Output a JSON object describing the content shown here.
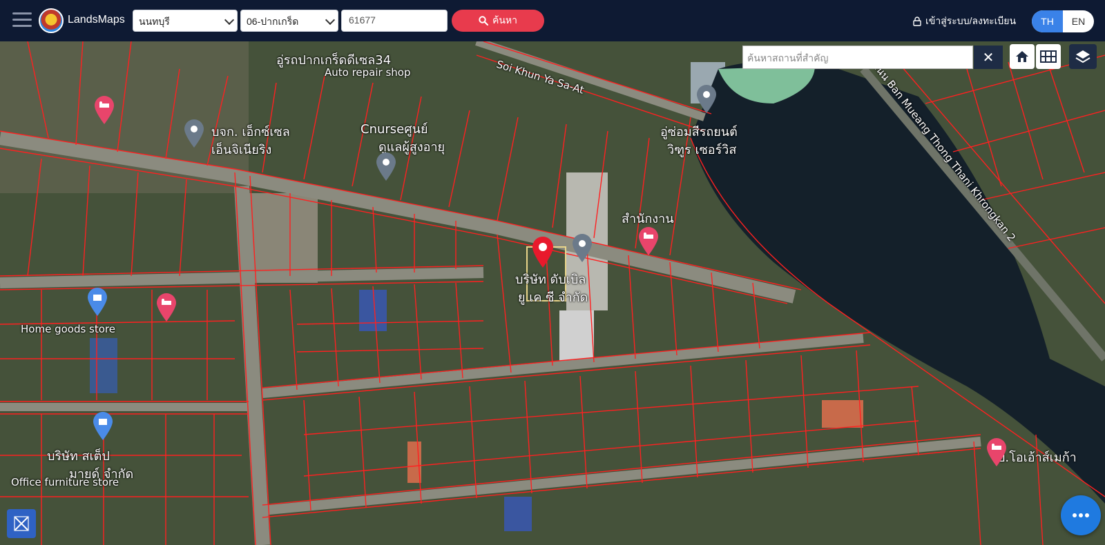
{
  "header": {
    "brand": "LandsMaps",
    "province_value": "นนทบุรี",
    "district_value": "06-ปากเกร็ด",
    "parcel_value": "61677",
    "search_label": "ค้นหา",
    "login_label": "เข้าสู่ระบบ/ลงทะเบียน",
    "lang_th": "TH",
    "lang_en": "EN"
  },
  "map": {
    "place_search_placeholder": "ค้นหาสถานที่สำคัญ",
    "clear_label": "✕",
    "labels": {
      "garage_th": "อู่รถปากเกร็ดดีเซล34",
      "garage_en": "Auto repair shop",
      "soi_khun": "Soi Khun Ya Sa-At",
      "xl_eng_1": "บจก. เอ็กซ์เซล",
      "xl_eng_2": "เอ็นจิเนียริง",
      "nurse_1": "Cnurseศูนย์",
      "nurse_2": "ดูแลผู้สูงอายุ",
      "car_repair_1": "อู่ซ่อมสีรถยนต์",
      "car_repair_2": "วิฑูร เซอร์วิส",
      "office": "สำนักงาน",
      "company_center_1": "บริษัท ดับเบิล",
      "company_center_2": "ยู เค ซี จำกัด",
      "home_goods": "Home goods store",
      "step_1": "บริษัท สเต็ป",
      "step_2": "มายด์ จำกัด",
      "office_furniture": "Office furniture store",
      "road_right": "ถนน Ban Mueang Thong Thani Khrongkan 2",
      "oasis": "บ.โอเอ้าส์เมก้า"
    }
  },
  "colors": {
    "header_bg": "#0e1a33",
    "search_red": "#e83b4d",
    "lang_blue": "#3a82e8",
    "parcel_line": "#ff2020",
    "marker_red": "#e8192c",
    "pin_pink": "#e8456b",
    "pin_grey": "#6b7a8a",
    "pin_blue": "#4a8be8",
    "highlight_box": "#e9d58a",
    "water": "#14202a",
    "fab_blue": "#1f7ae0"
  },
  "icons": [
    "menu-icon",
    "search-icon",
    "lock-icon",
    "home-icon",
    "grid-icon",
    "layers-icon",
    "measure-icon",
    "more-icon",
    "map-pin-icon",
    "hotel-pin-icon",
    "place-pin-icon",
    "shopping-pin-icon"
  ]
}
